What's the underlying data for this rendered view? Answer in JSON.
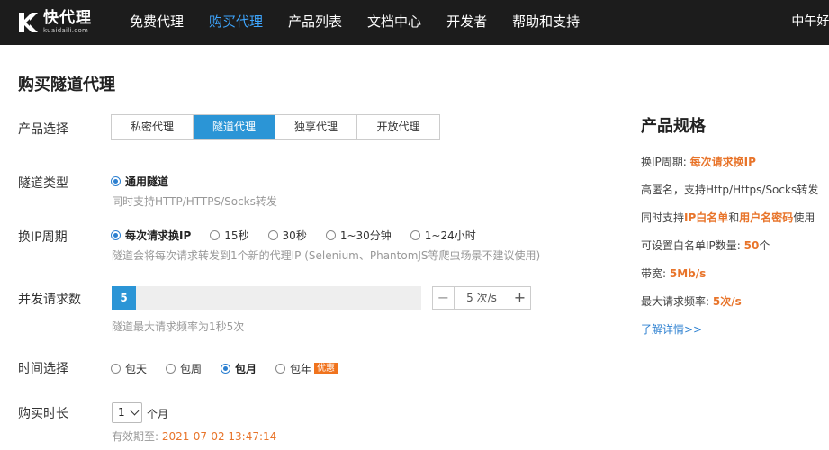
{
  "header": {
    "logo_cn": "快代理",
    "logo_en": "kuaidaili.com",
    "nav": [
      {
        "label": "免费代理",
        "active": false
      },
      {
        "label": "购买代理",
        "active": true
      },
      {
        "label": "产品列表",
        "active": false
      },
      {
        "label": "文档中心",
        "active": false
      },
      {
        "label": "开发者",
        "active": false
      },
      {
        "label": "帮助和支持",
        "active": false
      }
    ],
    "greeting": "中午好!"
  },
  "page": {
    "title": "购买隧道代理",
    "product": {
      "label": "产品选择",
      "tabs": [
        "私密代理",
        "隧道代理",
        "独享代理",
        "开放代理"
      ],
      "active_tab": "隧道代理"
    },
    "tunnel_type": {
      "label": "隧道类型",
      "option": "通用隧道",
      "hint": "同时支持HTTP/HTTPS/Socks转发"
    },
    "ip_cycle": {
      "label": "换IP周期",
      "options": [
        "每次请求换IP",
        "15秒",
        "30秒",
        "1~30分钟",
        "1~24小时"
      ],
      "selected": "每次请求换IP",
      "hint": "隧道会将每次请求转发到1个新的代理IP (Selenium、PhantomJS等爬虫场景不建议使用)"
    },
    "concurrency": {
      "label": "并发请求数",
      "slider_value": "5",
      "slider_fraction": 0.078,
      "stepper_minus": "−",
      "stepper_value": "5  次/s",
      "stepper_plus": "+",
      "hint": "隧道最大请求频率为1秒5次"
    },
    "time_select": {
      "label": "时间选择",
      "options": [
        "包天",
        "包周",
        "包月",
        "包年"
      ],
      "selected": "包月",
      "badge": "优惠"
    },
    "duration": {
      "label": "购买时长",
      "value": "1",
      "unit": "个月",
      "expiry_label": "有效期至: ",
      "expiry_date": "2021-07-02 13:47:14"
    }
  },
  "spec": {
    "title": "产品规格",
    "cycle_label": "换IP周期: ",
    "cycle_value": "每次请求换IP",
    "anonymity": "高匿名，支持Http/Https/Socks转发",
    "whitelist_pre": "同时支持",
    "whitelist_hl1": "IP白名单",
    "whitelist_mid": "和",
    "whitelist_hl2": "用户名密码",
    "whitelist_post": "使用",
    "ip_count_label": "可设置白名单IP数量: ",
    "ip_count_value": "50",
    "ip_count_unit": "个",
    "bandwidth_label": "带宽: ",
    "bandwidth_value": "5Mb/s",
    "max_freq_label": "最大请求频率: ",
    "max_freq_value": "5次/s",
    "more_link": "了解详情>>"
  },
  "colors": {
    "header_bg": "#1c1c1c",
    "nav_active": "#3ea6ff",
    "accent_blue": "#2b95d6",
    "highlight_orange": "#e8742a"
  }
}
